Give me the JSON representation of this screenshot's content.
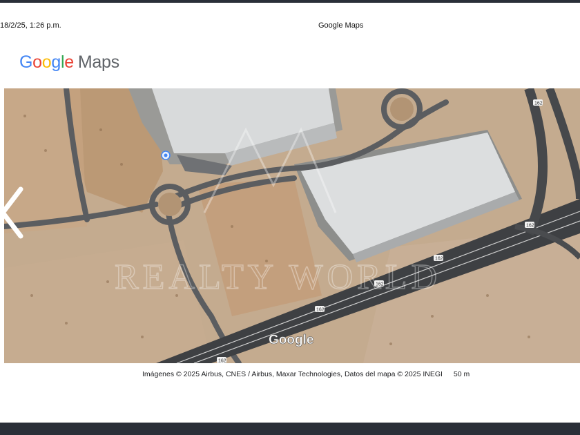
{
  "print_header": {
    "datetime": "18/2/25, 1:26 p.m.",
    "page_title": "Google Maps"
  },
  "logo": {
    "letters": [
      "G",
      "o",
      "o",
      "g",
      "l",
      "e"
    ],
    "suffix": "Maps",
    "colors": [
      "#4285F4",
      "#EA4335",
      "#FBBC05",
      "#4285F4",
      "#34A853",
      "#EA4335"
    ]
  },
  "map": {
    "view": "satellite",
    "watermark_logo": "Google",
    "road_labels": [
      "162",
      "162",
      "162",
      "162",
      "162",
      "162"
    ],
    "overlay_watermark": "REALTY WORLD",
    "icons": {
      "prev": "chevron-left-icon",
      "place": "place-marker-icon"
    },
    "colors": {
      "land": "#c4ab8f",
      "road": "#5b5d60",
      "roof": "#d8dadb",
      "highway": "#3e4043"
    }
  },
  "attribution": {
    "text": "Imágenes © 2025 Airbus, CNES / Airbus, Maxar Technologies, Datos del mapa © 2025 INEGI",
    "scale": "50 m"
  }
}
